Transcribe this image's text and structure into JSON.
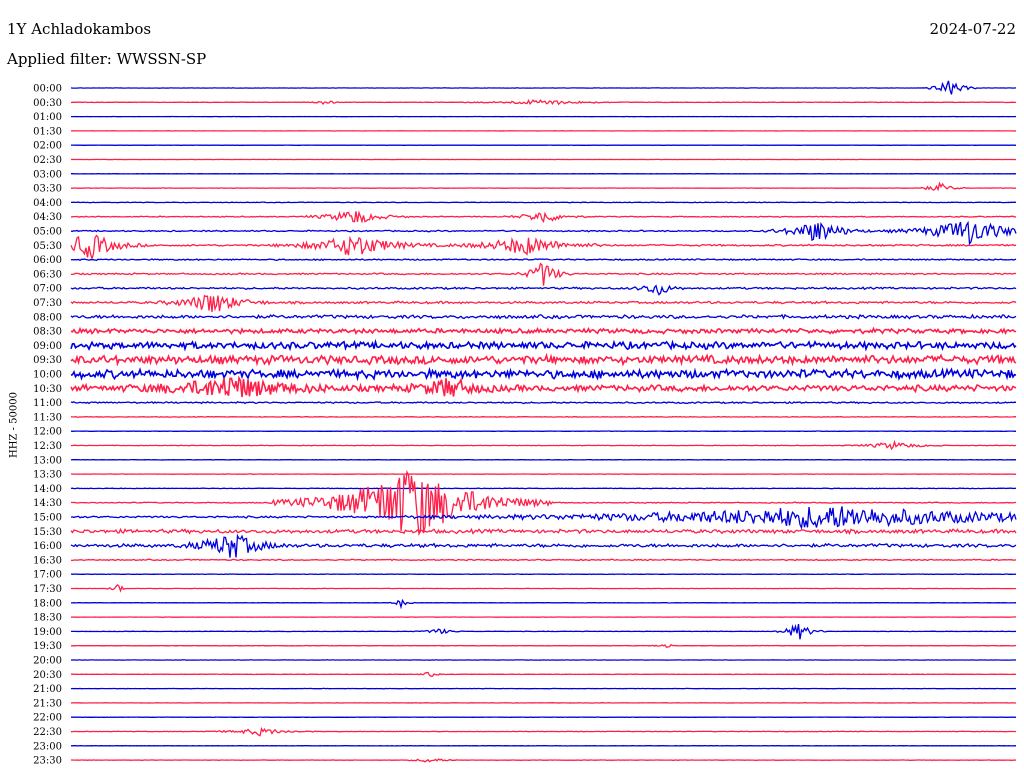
{
  "header": {
    "station": "1Y Achladokambos",
    "date": "2024-07-22",
    "filter_label": "Applied filter: WWSSN-SP"
  },
  "chart_data": {
    "type": "line",
    "title": "1Y Achladokambos",
    "subtitle": "Applied filter: WWSSN-SP",
    "ylabel": "HHZ - 50000",
    "date": "2024-07-22",
    "grid": false,
    "y_tick_labels": [
      "00:00",
      "00:30",
      "01:00",
      "01:30",
      "02:00",
      "02:30",
      "03:00",
      "03:30",
      "04:00",
      "04:30",
      "05:00",
      "05:30",
      "06:00",
      "06:30",
      "07:00",
      "07:30",
      "08:00",
      "08:30",
      "09:00",
      "09:30",
      "10:00",
      "10:30",
      "11:00",
      "11:30",
      "12:00",
      "12:30",
      "13:00",
      "13:30",
      "14:00",
      "14:30",
      "15:00",
      "15:30",
      "16:00",
      "16:30",
      "17:00",
      "17:30",
      "18:00",
      "18:30",
      "19:00",
      "19:30",
      "20:00",
      "20:30",
      "21:00",
      "21:30",
      "22:00",
      "22:30",
      "23:00",
      "23:30"
    ],
    "x_range_minutes": [
      0,
      30
    ],
    "series_colors": [
      "#0000dd",
      "#ff1f48"
    ],
    "trace_noise_level": [
      0.08,
      0.12,
      0.05,
      0.05,
      0.05,
      0.06,
      0.06,
      0.1,
      0.15,
      0.25,
      0.35,
      0.45,
      0.35,
      0.4,
      0.5,
      0.6,
      0.9,
      1.2,
      1.8,
      2.2,
      2.2,
      1.6,
      0.4,
      0.15,
      0.1,
      0.12,
      0.1,
      0.1,
      0.15,
      0.25,
      0.5,
      1.0,
      0.9,
      0.3,
      0.12,
      0.08,
      0.08,
      0.08,
      0.1,
      0.1,
      0.08,
      0.1,
      0.1,
      0.08,
      0.08,
      0.12,
      0.08,
      0.1
    ],
    "events": [
      {
        "trace": "00:00",
        "t": 0.93,
        "amp": 9,
        "width": 0.01
      },
      {
        "trace": "00:30",
        "t": 0.27,
        "amp": 3,
        "width": 0.005
      },
      {
        "trace": "00:30",
        "t": 0.5,
        "amp": 3,
        "width": 0.03
      },
      {
        "trace": "03:30",
        "t": 0.92,
        "amp": 5,
        "width": 0.01
      },
      {
        "trace": "04:30",
        "t": 0.3,
        "amp": 8,
        "width": 0.02
      },
      {
        "trace": "04:30",
        "t": 0.5,
        "amp": 7,
        "width": 0.015
      },
      {
        "trace": "05:00",
        "t": 0.79,
        "amp": 12,
        "width": 0.02
      },
      {
        "trace": "05:00",
        "t": 0.95,
        "amp": 14,
        "width": 0.03
      },
      {
        "trace": "05:30",
        "t": 0.02,
        "amp": 14,
        "width": 0.02
      },
      {
        "trace": "05:30",
        "t": 0.3,
        "amp": 12,
        "width": 0.03
      },
      {
        "trace": "05:30",
        "t": 0.48,
        "amp": 10,
        "width": 0.03
      },
      {
        "trace": "06:30",
        "t": 0.5,
        "amp": 14,
        "width": 0.01
      },
      {
        "trace": "07:00",
        "t": 0.62,
        "amp": 8,
        "width": 0.01
      },
      {
        "trace": "07:30",
        "t": 0.15,
        "amp": 12,
        "width": 0.02
      },
      {
        "trace": "10:30",
        "t": 0.17,
        "amp": 12,
        "width": 0.04
      },
      {
        "trace": "10:30",
        "t": 0.4,
        "amp": 10,
        "width": 0.02
      },
      {
        "trace": "12:30",
        "t": 0.87,
        "amp": 4,
        "width": 0.02
      },
      {
        "trace": "14:30",
        "t": 0.36,
        "amp": 40,
        "width": 0.05
      },
      {
        "trace": "15:00",
        "t": 0.8,
        "amp": 12,
        "width": 0.15
      },
      {
        "trace": "16:00",
        "t": 0.17,
        "amp": 14,
        "width": 0.02
      },
      {
        "trace": "17:30",
        "t": 0.05,
        "amp": 6,
        "width": 0.004
      },
      {
        "trace": "18:00",
        "t": 0.35,
        "amp": 5,
        "width": 0.005
      },
      {
        "trace": "19:00",
        "t": 0.39,
        "amp": 3,
        "width": 0.01
      },
      {
        "trace": "19:00",
        "t": 0.77,
        "amp": 9,
        "width": 0.01
      },
      {
        "trace": "19:30",
        "t": 0.63,
        "amp": 3,
        "width": 0.005
      },
      {
        "trace": "20:30",
        "t": 0.38,
        "amp": 3,
        "width": 0.005
      },
      {
        "trace": "22:30",
        "t": 0.2,
        "amp": 4,
        "width": 0.02
      },
      {
        "trace": "23:30",
        "t": 0.38,
        "amp": 3,
        "width": 0.01
      }
    ]
  }
}
